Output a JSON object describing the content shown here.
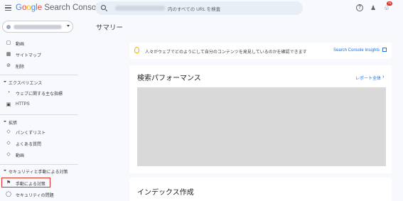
{
  "header": {
    "logo_google": "Google",
    "logo_product": "Search Console",
    "search_placeholder_tail": "内のすべての URL を検査",
    "notification_count": "76"
  },
  "sidebar": {
    "items_top": [
      {
        "label": "動画",
        "icon": "video-icon"
      },
      {
        "label": "サイトマップ",
        "icon": "sitemap-icon"
      },
      {
        "label": "削除",
        "icon": "removal-icon"
      }
    ],
    "section_experience": "エクスペリエンス",
    "items_experience": [
      {
        "label": "ウェブに関する主な指標",
        "icon": "speed-icon"
      },
      {
        "label": "HTTPS",
        "icon": "lock-icon"
      }
    ],
    "section_enhancements": "拡張",
    "items_enhancements": [
      {
        "label": "パンくずリスト",
        "icon": "layers-icon"
      },
      {
        "label": "よくある質問",
        "icon": "layers-icon"
      },
      {
        "label": "動画",
        "icon": "layers-icon"
      }
    ],
    "section_security": "セキュリティと手動による対策",
    "items_security": [
      {
        "label": "手動による対策",
        "icon": "flag-icon"
      },
      {
        "label": "セキュリティの問題",
        "icon": "shield-icon"
      }
    ]
  },
  "main": {
    "page_title": "サマリー",
    "banner_text": "人々がウェブでどのようにして自分のコンテンツを発見しているのかを確認できます",
    "banner_link": "Search Console Insights",
    "performance_title": "検索パフォーマンス",
    "full_report_link": "レポート全体",
    "index_title": "インデックス作成"
  }
}
